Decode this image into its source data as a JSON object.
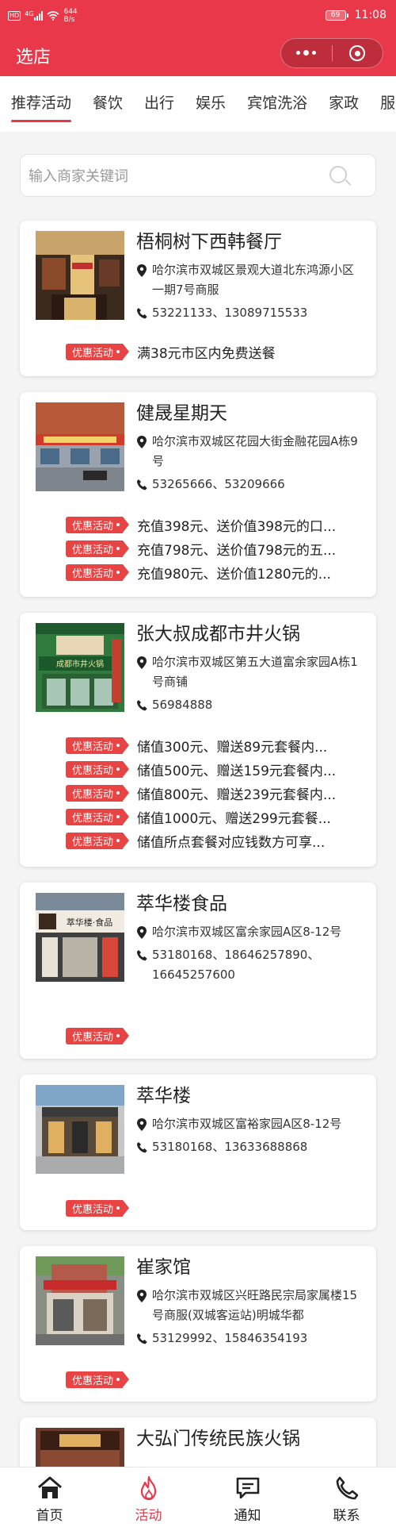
{
  "status_bar": {
    "network_badge": "HD",
    "network_type": "4G",
    "speed_value": "644",
    "speed_unit": "B/s",
    "battery": "69",
    "time": "11:08"
  },
  "nav": {
    "title": "选店"
  },
  "tabs": [
    "推荐活动",
    "餐饮",
    "出行",
    "娱乐",
    "宾馆洗浴",
    "家政",
    "服"
  ],
  "search": {
    "placeholder": "输入商家关键词"
  },
  "promo_tag_label": "优惠活动",
  "stores": [
    {
      "name": "梧桐树下西韩餐厅",
      "address": "哈尔滨市双城区景观大道北东鸿源小区一期7号商服",
      "phone": "53221133、13089715533",
      "promos": [
        "满38元市区内免费送餐"
      ]
    },
    {
      "name": "健晟星期天",
      "address": "哈尔滨市双城区花园大街金融花园A栋9号",
      "phone": "53265666、53209666",
      "promos": [
        "充值398元、送价值398元的口...",
        "充值798元、送价值798元的五...",
        "充值980元、送价值1280元的..."
      ]
    },
    {
      "name": "张大叔成都市井火锅",
      "address": "哈尔滨市双城区第五大道富余家园A栋1号商铺",
      "phone": "56984888",
      "promos": [
        "储值300元、赠送89元套餐内...",
        "储值500元、赠送159元套餐内...",
        "储值800元、赠送239元套餐内...",
        "储值1000元、赠送299元套餐...",
        "储值所点套餐对应钱数方可享..."
      ],
      "sign_text": "成都市井火锅"
    },
    {
      "name": "萃华楼食品",
      "address": "哈尔滨市双城区富余家园A区8-12号",
      "phone": "53180168、18646257890、16645257600",
      "promos": [
        ""
      ],
      "sign_text": "萃华楼·食品"
    },
    {
      "name": "萃华楼",
      "address": "哈尔滨市双城区富裕家园A区8-12号",
      "phone": "53180168、13633688868",
      "promos": [
        ""
      ]
    },
    {
      "name": "崔家馆",
      "address": "哈尔滨市双城区兴旺路民宗局家属楼15号商服(双城客运站)明城华都",
      "phone": "53129992、15846354193",
      "promos": [
        ""
      ]
    },
    {
      "name": "大弘门传统民族火锅",
      "address": "",
      "phone": "",
      "promos": []
    }
  ],
  "tabbar": [
    {
      "label": "首页",
      "icon": "home-icon"
    },
    {
      "label": "活动",
      "icon": "flame-icon"
    },
    {
      "label": "通知",
      "icon": "message-icon"
    },
    {
      "label": "联系",
      "icon": "phone-icon"
    }
  ],
  "colors": {
    "brand": "#e8384a",
    "promo_tag": "#e84444",
    "background": "#f4f4f4"
  }
}
